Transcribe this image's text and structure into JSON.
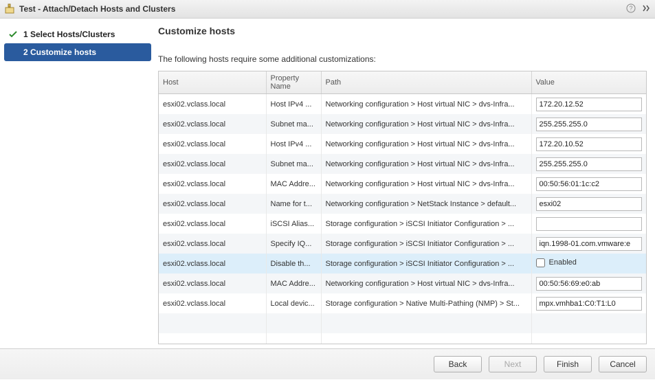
{
  "window": {
    "title": "Test - Attach/Detach Hosts and Clusters"
  },
  "nav": {
    "step1": {
      "label": "1  Select Hosts/Clusters",
      "done": true
    },
    "step2": {
      "label": "2  Customize hosts",
      "active": true
    }
  },
  "main": {
    "heading": "Customize hosts",
    "subtitle": "The following hosts require some additional customizations:"
  },
  "columns": {
    "host": "Host",
    "property": "Property Name",
    "path": "Path",
    "value": "Value"
  },
  "rows": [
    {
      "host": "esxi02.vclass.local",
      "property": "Host IPv4 ...",
      "path": "Networking configuration > Host virtual NIC > dvs-Infra...",
      "type": "text",
      "value": "172.20.12.52"
    },
    {
      "host": "esxi02.vclass.local",
      "property": "Subnet ma...",
      "path": "Networking configuration > Host virtual NIC > dvs-Infra...",
      "type": "text",
      "value": "255.255.255.0"
    },
    {
      "host": "esxi02.vclass.local",
      "property": "Host IPv4 ...",
      "path": "Networking configuration > Host virtual NIC > dvs-Infra...",
      "type": "text",
      "value": "172.20.10.52"
    },
    {
      "host": "esxi02.vclass.local",
      "property": "Subnet ma...",
      "path": "Networking configuration > Host virtual NIC > dvs-Infra...",
      "type": "text",
      "value": "255.255.255.0"
    },
    {
      "host": "esxi02.vclass.local",
      "property": "MAC Addre...",
      "path": "Networking configuration > Host virtual NIC > dvs-Infra...",
      "type": "text",
      "value": "00:50:56:01:1c:c2"
    },
    {
      "host": "esxi02.vclass.local",
      "property": "Name for t...",
      "path": "Networking configuration > NetStack Instance > default...",
      "type": "text",
      "value": "esxi02"
    },
    {
      "host": "esxi02.vclass.local",
      "property": "iSCSI Alias...",
      "path": "Storage configuration > iSCSI Initiator Configuration > ...",
      "type": "text",
      "value": ""
    },
    {
      "host": "esxi02.vclass.local",
      "property": "Specify IQ...",
      "path": "Storage configuration > iSCSI Initiator Configuration > ...",
      "type": "text",
      "value": "iqn.1998-01.com.vmware:e"
    },
    {
      "host": "esxi02.vclass.local",
      "property": "Disable th...",
      "path": "Storage configuration > iSCSI Initiator Configuration > ...",
      "type": "checkbox",
      "checked": false,
      "checkbox_label": "Enabled",
      "selected": true
    },
    {
      "host": "esxi02.vclass.local",
      "property": "MAC Addre...",
      "path": "Networking configuration > Host virtual NIC > dvs-Infra...",
      "type": "text",
      "value": "00:50:56:69:e0:ab"
    },
    {
      "host": "esxi02.vclass.local",
      "property": "Local devic...",
      "path": "Storage configuration > Native Multi-Pathing (NMP) > St...",
      "type": "text",
      "value": "mpx.vmhba1:C0:T1:L0"
    }
  ],
  "buttons": {
    "back": "Back",
    "next": "Next",
    "finish": "Finish",
    "cancel": "Cancel"
  }
}
